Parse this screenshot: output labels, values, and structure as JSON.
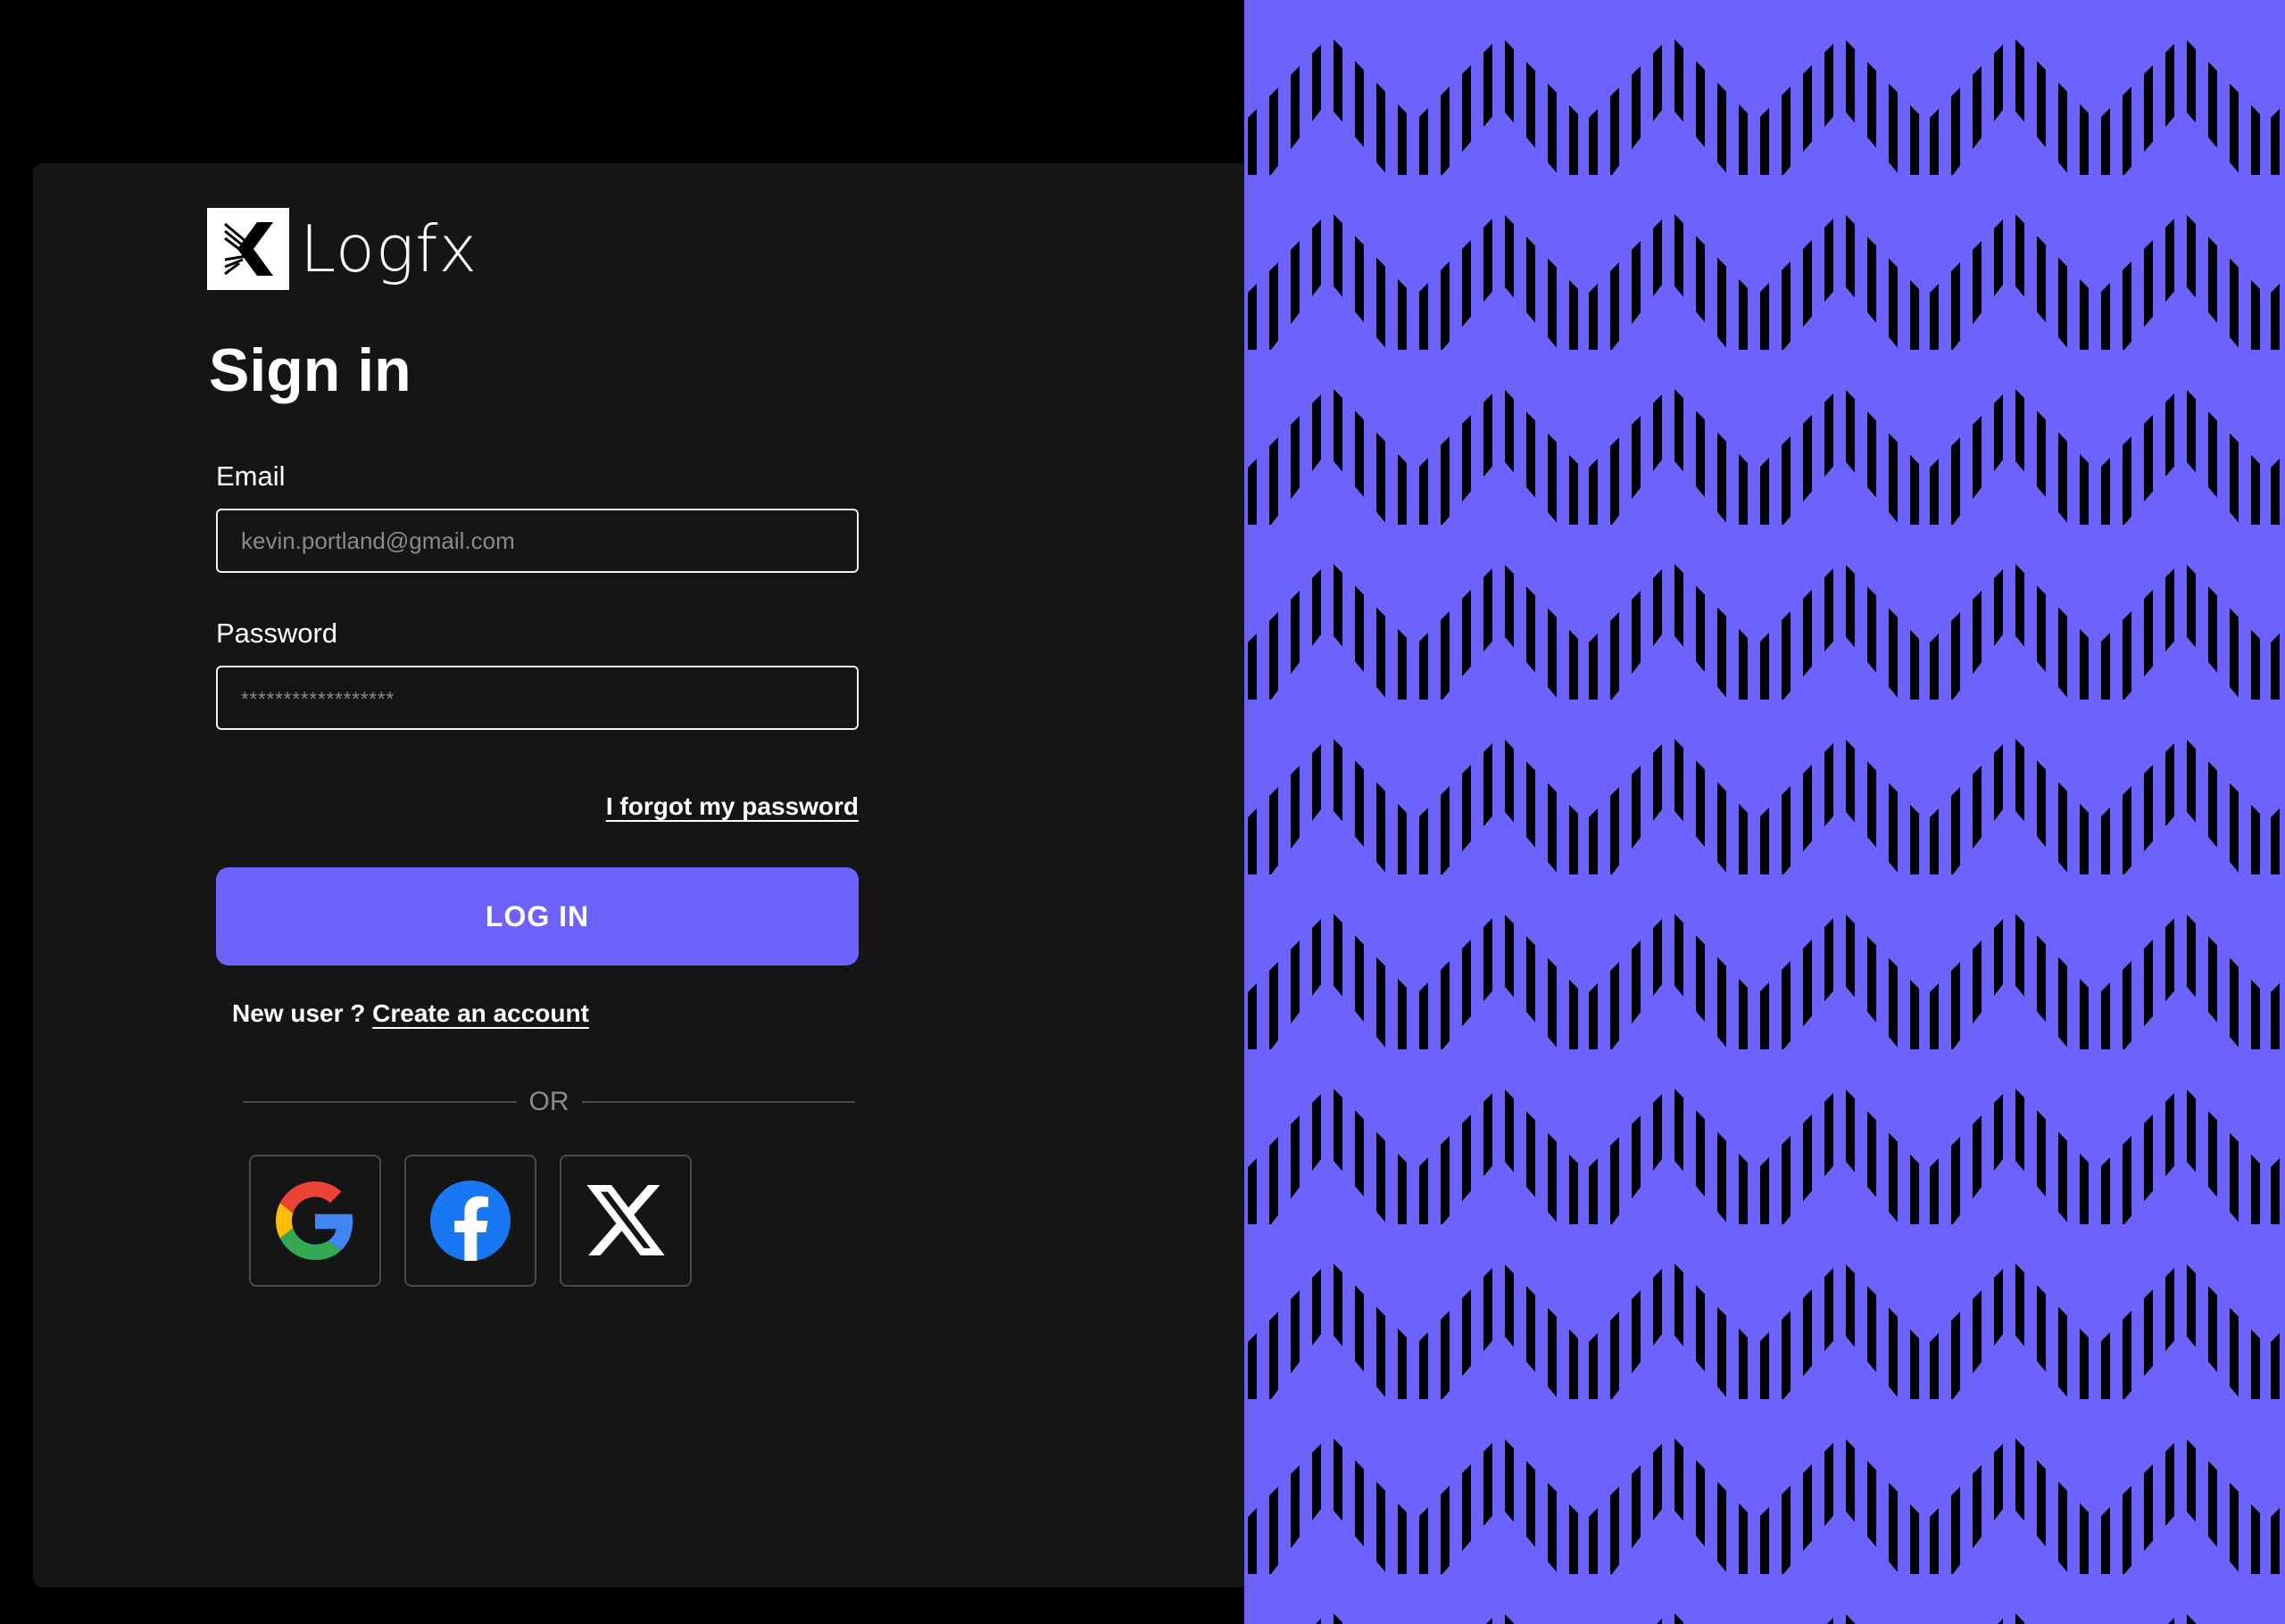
{
  "brand": {
    "name": "Logfx",
    "accent_color": "#6c63ff",
    "logo_icon": "logfx-logo-icon"
  },
  "form": {
    "title": "Sign in",
    "email": {
      "label": "Email",
      "placeholder": "kevin.portland@gmail.com",
      "value": ""
    },
    "password": {
      "label": "Password",
      "placeholder": "******************",
      "value": ""
    },
    "forgot_link": "I forgot my password",
    "login_button": "LOG IN",
    "new_user_prefix": "New user ?",
    "create_account_link": "Create an account",
    "divider_text": "OR"
  },
  "social": {
    "google_icon": "google-icon",
    "facebook_icon": "facebook-icon",
    "x_icon": "x-icon"
  },
  "colors": {
    "background": "#000000",
    "card": "#151515",
    "pattern_fill": "#6c63ff",
    "pattern_stripes": "#000000"
  }
}
